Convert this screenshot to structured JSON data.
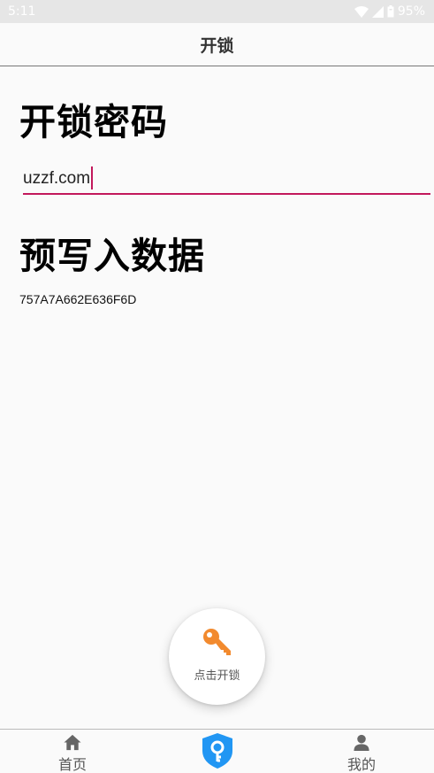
{
  "status_bar": {
    "time": "5:11",
    "battery": "95%"
  },
  "app_bar": {
    "title": "开锁"
  },
  "password_section": {
    "heading": "开锁密码",
    "value": "uzzf.com"
  },
  "data_section": {
    "heading": "预写入数据",
    "hex_value": "757A7A662E636F6D"
  },
  "fab": {
    "label": "点击开锁",
    "icon": "key-icon"
  },
  "bottom_nav": {
    "items": [
      {
        "label": "首页",
        "icon": "home-icon"
      },
      {
        "label": "",
        "icon": "shield-key-icon"
      },
      {
        "label": "我的",
        "icon": "person-icon"
      }
    ]
  },
  "colors": {
    "accent": "#c2185b",
    "key_orange": "#f28a2e",
    "shield_blue": "#2196f3"
  }
}
